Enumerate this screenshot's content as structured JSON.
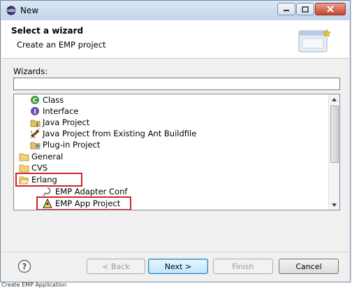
{
  "window": {
    "title": "New",
    "buttons": [
      "minimize",
      "maximize",
      "close"
    ]
  },
  "header": {
    "title": "Select a wizard",
    "description": "Create an EMP project"
  },
  "wizards": {
    "label": "Wizards:",
    "filter_value": "",
    "items": [
      {
        "label": "Class",
        "icon": "java-class-icon",
        "indent": 1
      },
      {
        "label": "Interface",
        "icon": "java-interface-icon",
        "indent": 1
      },
      {
        "label": "Java Project",
        "icon": "java-project-icon",
        "indent": 1
      },
      {
        "label": "Java Project from Existing Ant Buildfile",
        "icon": "ant-project-icon",
        "indent": 1
      },
      {
        "label": "Plug-in Project",
        "icon": "plugin-project-icon",
        "indent": 1
      },
      {
        "label": "General",
        "icon": "folder-icon",
        "indent": 0
      },
      {
        "label": "CVS",
        "icon": "folder-icon",
        "indent": 0
      },
      {
        "label": "Erlang",
        "icon": "folder-open-icon",
        "indent": 0,
        "expanded": true,
        "highlighted": true
      },
      {
        "label": "EMP Adapter Conf",
        "icon": "adapter-conf-icon",
        "indent": 1
      },
      {
        "label": "EMP App Project",
        "icon": "app-project-icon",
        "indent": 1,
        "highlighted": true
      }
    ]
  },
  "footer": {
    "help_icon": "help-icon",
    "back": "< Back",
    "next": "Next >",
    "finish": "Finish",
    "cancel": "Cancel"
  },
  "bottom_strip_text": "Create EMP Application"
}
